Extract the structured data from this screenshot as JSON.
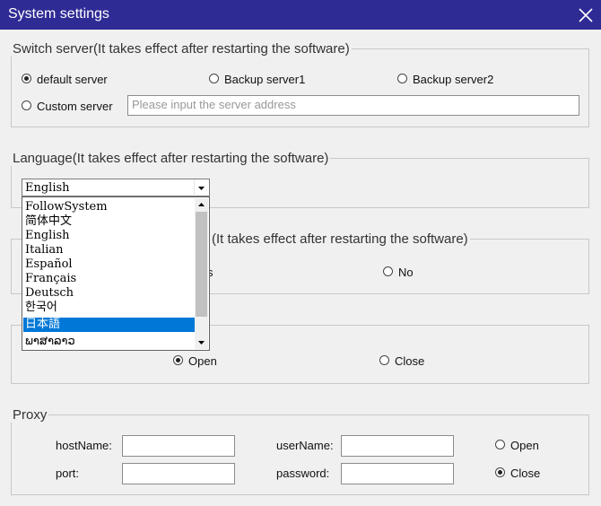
{
  "window": {
    "title": "System settings"
  },
  "server": {
    "legend": "Switch server(It takes effect after restarting the software)",
    "options": [
      "default server",
      "Backup server1",
      "Backup server2",
      "Custom server"
    ],
    "selected": "default server",
    "address_placeholder": "Please input the server address"
  },
  "language": {
    "legend": "Language(It takes effect after restarting the software)",
    "selected": "English",
    "options": [
      "FollowSystem",
      "简体中文",
      "English",
      "Italian",
      "Español",
      "Français",
      "Deutsch",
      "한국어",
      "日本語",
      "ພາສາລາວ"
    ],
    "highlighted": "日本語"
  },
  "section3": {
    "legend_visible": "(It takes effect after restarting the software)",
    "yes_visible": "s",
    "no_label": "No"
  },
  "section4": {
    "open_label": "Open",
    "close_label": "Close"
  },
  "proxy": {
    "legend": "Proxy",
    "host_label": "hostName:",
    "port_label": "port:",
    "user_label": "userName:",
    "password_label": "password:",
    "open_label": "Open",
    "close_label": "Close",
    "selected": "Close"
  }
}
